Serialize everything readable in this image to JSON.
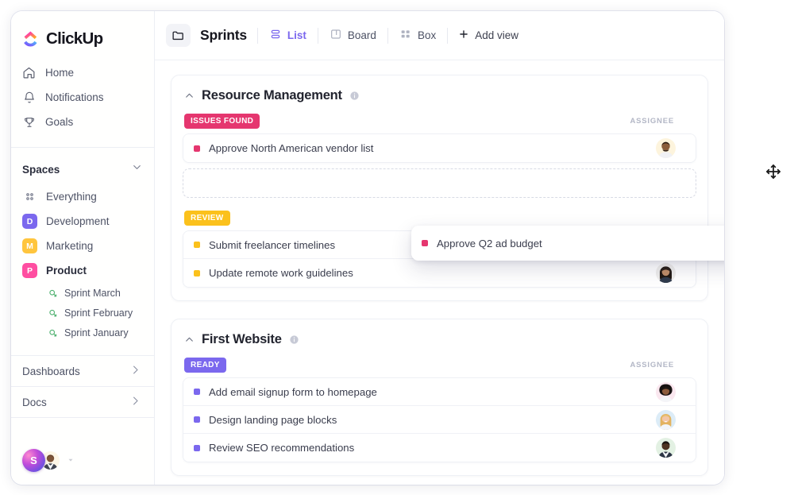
{
  "brand": {
    "name": "ClickUp",
    "logo_icon": "clickup-logo-icon"
  },
  "sidebar": {
    "nav": [
      {
        "label": "Home",
        "icon": "home-icon"
      },
      {
        "label": "Notifications",
        "icon": "bell-icon"
      },
      {
        "label": "Goals",
        "icon": "trophy-icon"
      }
    ],
    "spaces": {
      "title": "Spaces",
      "collapse_icon": "chevron-down-icon",
      "items": [
        {
          "label": "Everything",
          "icon": "grid-dots-icon",
          "type": "everything"
        },
        {
          "label": "Development",
          "initial": "D",
          "color": "#7b68ee",
          "type": "space"
        },
        {
          "label": "Marketing",
          "initial": "M",
          "color": "#ffc53d",
          "type": "space"
        },
        {
          "label": "Product",
          "initial": "P",
          "color": "#ff4ea1",
          "type": "space",
          "active": true
        }
      ],
      "sprints": [
        {
          "label": "Sprint  March",
          "icon": "sprint-icon"
        },
        {
          "label": "Sprint  February",
          "icon": "sprint-icon"
        },
        {
          "label": "Sprint January",
          "icon": "sprint-icon"
        }
      ]
    },
    "footer_links": [
      {
        "label": "Dashboards",
        "icon": "chevron-right-icon"
      },
      {
        "label": "Docs",
        "icon": "chevron-right-icon"
      }
    ],
    "user_dock": {
      "workspace_initial": "S",
      "avatar_name": "user-avatar",
      "caret_icon": "caret-down-icon"
    }
  },
  "toolbar": {
    "folder_icon": "folder-icon",
    "title": "Sprints",
    "views": [
      {
        "label": "List",
        "icon": "list-view-icon",
        "active": true
      },
      {
        "label": "Board",
        "icon": "board-view-icon",
        "active": false
      },
      {
        "label": "Box",
        "icon": "box-view-icon",
        "active": false
      }
    ],
    "add_view": {
      "label": "Add view",
      "icon": "plus-icon"
    }
  },
  "board": {
    "assignee_header": "ASSIGNEE",
    "groups": [
      {
        "title": "Resource Management",
        "collapse_icon": "caret-up-icon",
        "info_icon": "info-icon",
        "statuses": [
          {
            "label": "ISSUES FOUND",
            "color": "#e5366f",
            "dot_color": "#e5366f",
            "show_assignee_header": true,
            "tasks": [
              {
                "name": "Approve North American vendor list",
                "avatar": "avatar-1"
              }
            ],
            "drop_placeholder": true
          },
          {
            "label": "REVIEW",
            "color": "#fbc11c",
            "dot_color": "#fbc11c",
            "show_assignee_header": false,
            "tasks": [
              {
                "name": "Submit freelancer timelines",
                "avatar": "avatar-2"
              },
              {
                "name": "Update remote work guidelines",
                "avatar": "avatar-3"
              }
            ],
            "drop_placeholder": false
          }
        ]
      },
      {
        "title": "First Website",
        "collapse_icon": "caret-up-icon",
        "info_icon": "info-icon",
        "statuses": [
          {
            "label": "READY",
            "color": "#7b68ee",
            "dot_color": "#7b68ee",
            "show_assignee_header": true,
            "tasks": [
              {
                "name": "Add email signup form to homepage",
                "avatar": "avatar-4"
              },
              {
                "name": "Design landing page blocks",
                "avatar": "avatar-5"
              },
              {
                "name": "Review SEO recommendations",
                "avatar": "avatar-6"
              }
            ],
            "drop_placeholder": false
          }
        ]
      }
    ]
  },
  "drag": {
    "task_name": "Approve Q2 ad budget",
    "dot_color": "#e5366f",
    "avatar": "avatar-dragged",
    "cursor_icon": "move-cursor-icon"
  }
}
